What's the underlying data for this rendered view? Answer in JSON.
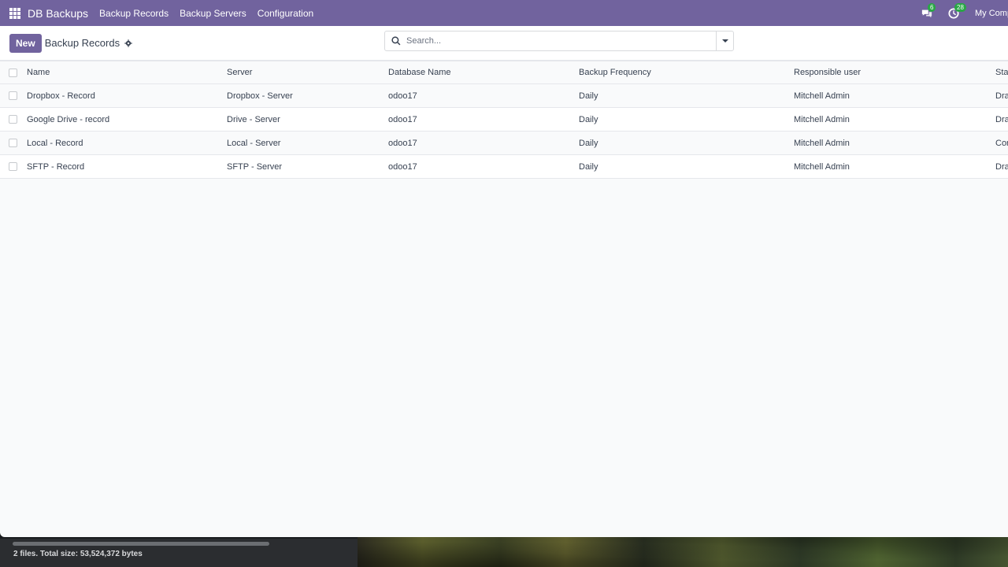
{
  "navbar": {
    "brand": "DB Backups",
    "menu": [
      "Backup Records",
      "Backup Servers",
      "Configuration"
    ],
    "messages_count": "6",
    "activities_count": "28",
    "company": "My Comp"
  },
  "control_panel": {
    "new_label": "New",
    "title": "Backup Records",
    "search_placeholder": "Search..."
  },
  "table": {
    "headers": [
      "Name",
      "Server",
      "Database Name",
      "Backup Frequency",
      "Responsible user",
      "Sta"
    ],
    "rows": [
      [
        "Dropbox - Record",
        "Dropbox - Server",
        "odoo17",
        "Daily",
        "Mitchell Admin",
        "Dra"
      ],
      [
        "Google Drive - record",
        "Drive - Server",
        "odoo17",
        "Daily",
        "Mitchell Admin",
        "Dra"
      ],
      [
        "Local - Record",
        "Local - Server",
        "odoo17",
        "Daily",
        "Mitchell Admin",
        "Cor"
      ],
      [
        "SFTP - Record",
        "SFTP - Server",
        "odoo17",
        "Daily",
        "Mitchell Admin",
        "Dra"
      ]
    ]
  },
  "status_bar": {
    "file_info": "2 files. Total size: 53,524,372 bytes"
  },
  "colors": {
    "navbar": "#71639e",
    "primary_button": "#71639e",
    "badge": "#28a745"
  },
  "icons": {
    "apps": "apps-grid-icon",
    "messages": "chat-bubbles-icon",
    "activities": "clock-icon",
    "settings": "gear-icon",
    "search": "search-icon",
    "dropdown": "caret-down-icon"
  }
}
